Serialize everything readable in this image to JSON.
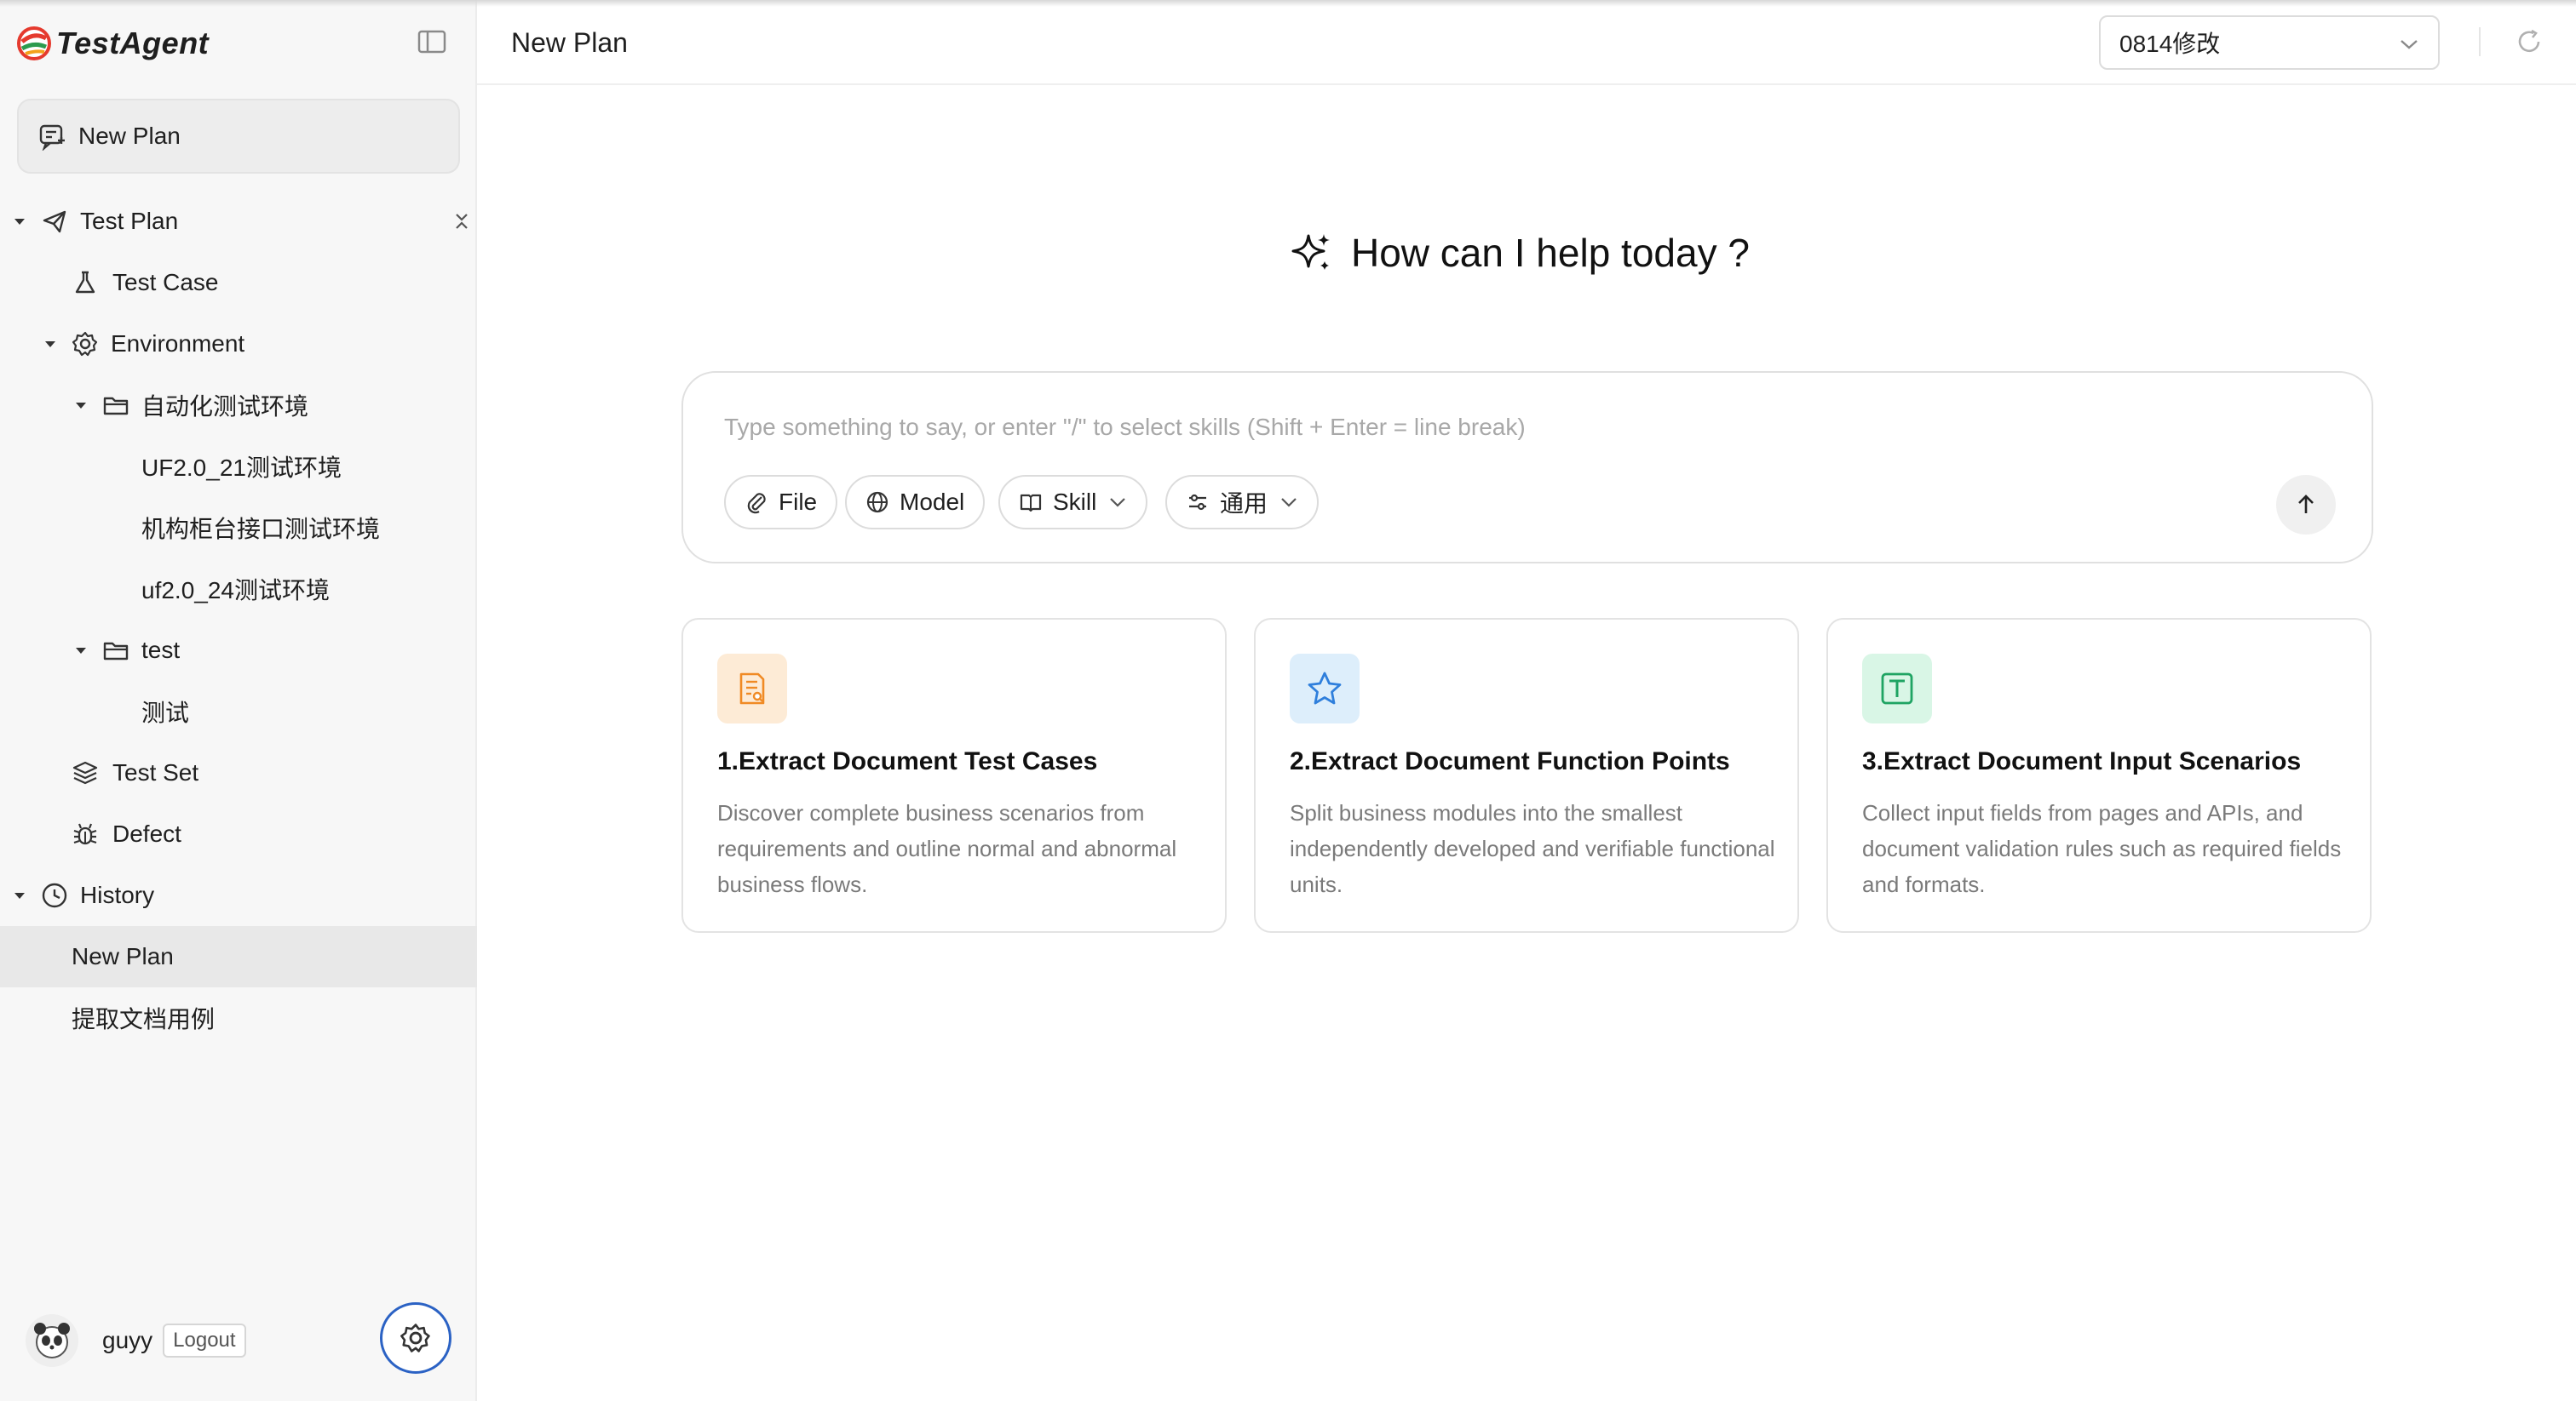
{
  "app": {
    "name": "TestAgent"
  },
  "sidebar": {
    "new_plan_label": "New Plan",
    "tree": [
      {
        "label": "Test Plan",
        "icon": "paper-plane-icon"
      },
      {
        "label": "Test Case",
        "icon": "flask-icon"
      },
      {
        "label": "Environment",
        "icon": "gear-icon"
      },
      {
        "label": "自动化测试环境",
        "icon": "folder-icon"
      },
      {
        "label": "UF2.0_21测试环境"
      },
      {
        "label": "机构柜台接口测试环境"
      },
      {
        "label": "uf2.0_24测试环境"
      },
      {
        "label": "test",
        "icon": "folder-icon"
      },
      {
        "label": "测试"
      },
      {
        "label": "Test Set",
        "icon": "layers-icon"
      },
      {
        "label": "Defect",
        "icon": "bug-icon"
      },
      {
        "label": "History",
        "icon": "clock-icon"
      },
      {
        "label": "New Plan",
        "active": true
      },
      {
        "label": "提取文档用例"
      }
    ],
    "user": {
      "name": "guyy",
      "logout_label": "Logout"
    }
  },
  "header": {
    "title": "New Plan",
    "selected_option": "0814修改"
  },
  "main": {
    "greeting": "How can I help today ?",
    "composer": {
      "placeholder": "Type something to say, or enter \"/\" to select skills (Shift + Enter = line break)",
      "chips": [
        "File",
        "Model",
        "Skill",
        "通用"
      ]
    },
    "cards": [
      {
        "title": "1.Extract Document Test Cases",
        "desc": "Discover complete business scenarios from requirements and outline normal and abnormal business flows.",
        "icon": "document-search-icon",
        "color": "#f08a24",
        "bg": "#fdebd6"
      },
      {
        "title": "2.Extract Document Function Points",
        "desc": "Split business modules into the smallest independently developed and verifiable functional units.",
        "icon": "star-icon",
        "color": "#2f7fdc",
        "bg": "#ddeefb"
      },
      {
        "title": "3.Extract Document Input Scenarios",
        "desc": "Collect input fields from pages and APIs, and document validation rules such as required fields and formats.",
        "icon": "text-box-icon",
        "color": "#1fa463",
        "bg": "#d9f6e6"
      }
    ]
  },
  "colors": {
    "accent_blue": "#2b62c4",
    "sidebar_bg": "#f7f7f7",
    "active_row": "#e8e8e8"
  }
}
